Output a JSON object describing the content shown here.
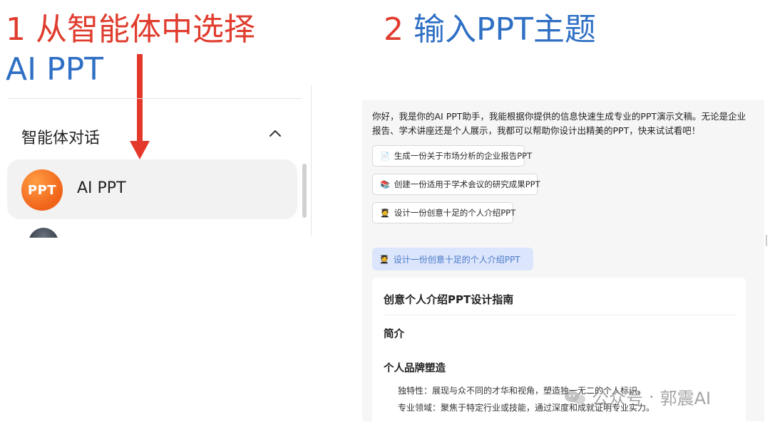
{
  "headings": {
    "step1_number": "1 ",
    "step1_text": "从智能体中选择",
    "step1_sub": "AI PPT",
    "step2_number": "2 ",
    "step2_text": "输入PPT主题"
  },
  "sidebar": {
    "section_title": "智能体对话",
    "items": [
      {
        "avatar_text": "PPT",
        "label": "AI PPT"
      }
    ]
  },
  "chat": {
    "greeting": "你好，我是你的AI PPT助手，我能根据你提供的信息快速生成专业的PPT演示文稿。无论是企业报告、学术讲座还是个人展示，我都可以帮助你设计出精美的PPT，快来试试看吧！",
    "suggestions": [
      {
        "emoji": "📄",
        "label": "生成一份关于市场分析的企业报告PPT"
      },
      {
        "emoji": "📚",
        "label": "创建一份适用于学术会议的研究成果PPT"
      },
      {
        "emoji": "🧑‍🎓",
        "label": "设计一份创意十足的个人介绍PPT"
      }
    ],
    "user_message": {
      "emoji": "🧑‍🎓",
      "text": "设计一份创意十足的个人介绍PPT"
    },
    "answer": {
      "title": "创意个人介绍PPT设计指南",
      "section1": "简介",
      "section2": "个人品牌塑造",
      "line1": "独特性：展现与众不同的才华和视角，塑造独一无二的个人标识。",
      "line2": "专业领域：聚焦于特定行业或技能，通过深度和成就证明专业实力。"
    }
  },
  "watermark": {
    "text1": "公众号",
    "dot": "·",
    "text2": "郭震AI"
  },
  "colors": {
    "heading_red": "#e03c2e",
    "heading_blue": "#2f6fc4",
    "arrow_red": "#e4382b",
    "avatar_orange": "#f06318",
    "user_bubble": "#dbe5fb"
  }
}
